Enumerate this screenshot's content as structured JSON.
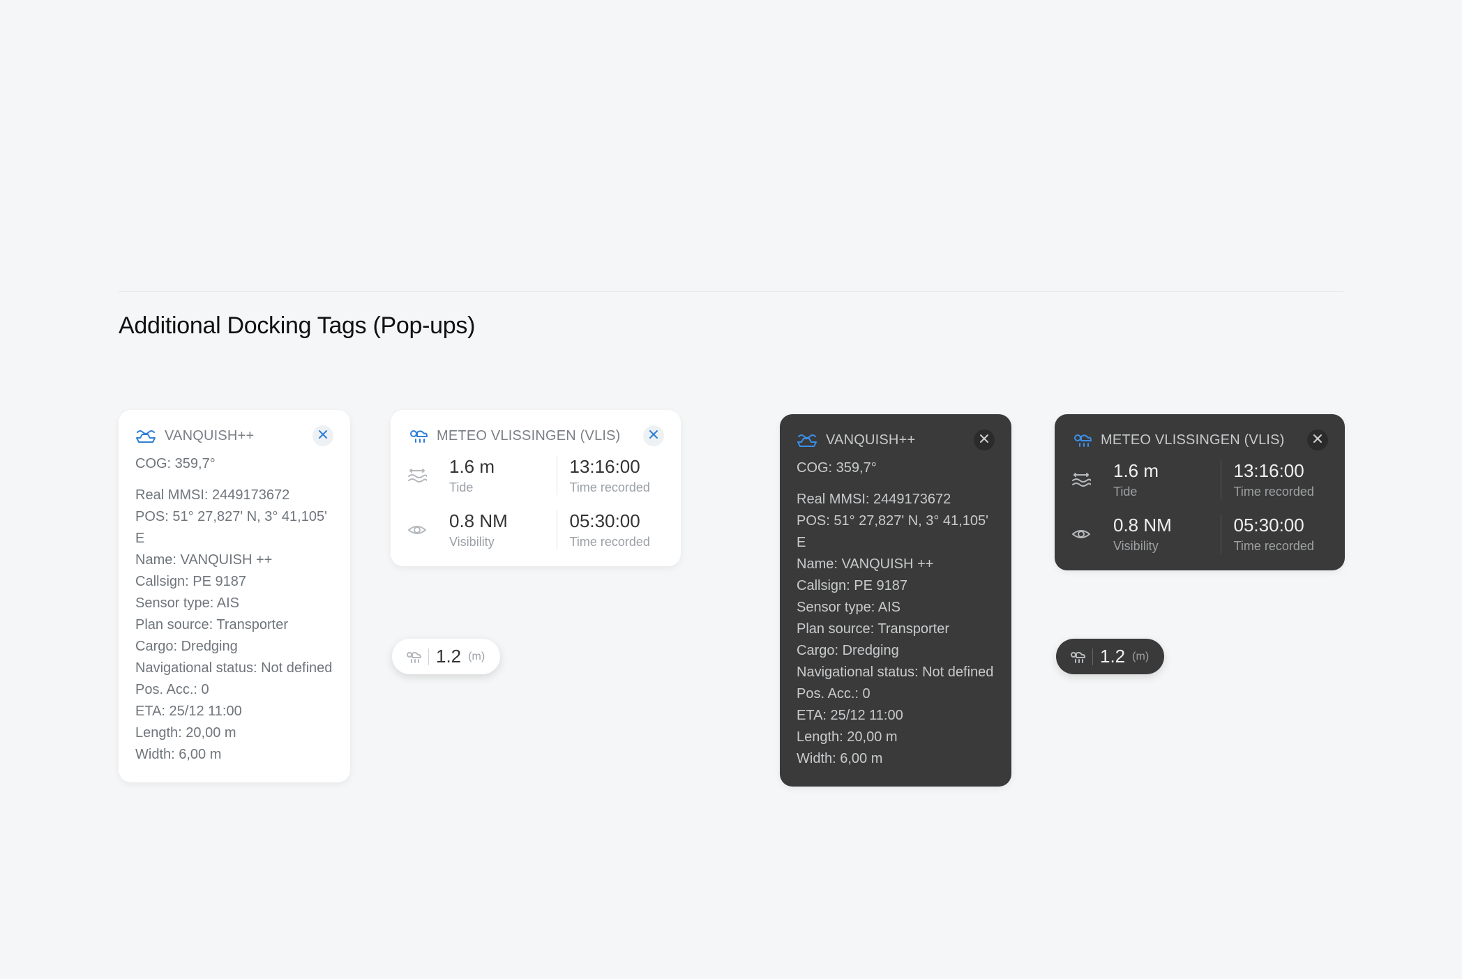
{
  "section_title": "Additional Docking Tags (Pop-ups)",
  "vessel": {
    "title": "VANQUISH++",
    "cog": "COG: 359,7°",
    "lines": [
      "Real MMSI: 2449173672",
      "POS: 51° 27,827' N, 3° 41,105' E",
      "Name: VANQUISH ++",
      "Callsign: PE 9187",
      "Sensor type: AIS",
      "Plan source: Transporter",
      "Cargo: Dredging",
      "Navigational status: Not defined",
      "Pos. Acc.: 0",
      "ETA: 25/12 11:00",
      "Length: 20,00 m",
      "Width: 6,00 m"
    ]
  },
  "meteo": {
    "title": "METEO VLISSINGEN (VLIS)",
    "tide_val": "1.6 m",
    "tide_lab": "Tide",
    "tide_time": "13:16:00",
    "vis_val": "0.8 NM",
    "vis_lab": "Visibility",
    "vis_time": "05:30:00",
    "time_lab": "Time recorded"
  },
  "pill": {
    "value": "1.2",
    "unit": "(m)"
  }
}
